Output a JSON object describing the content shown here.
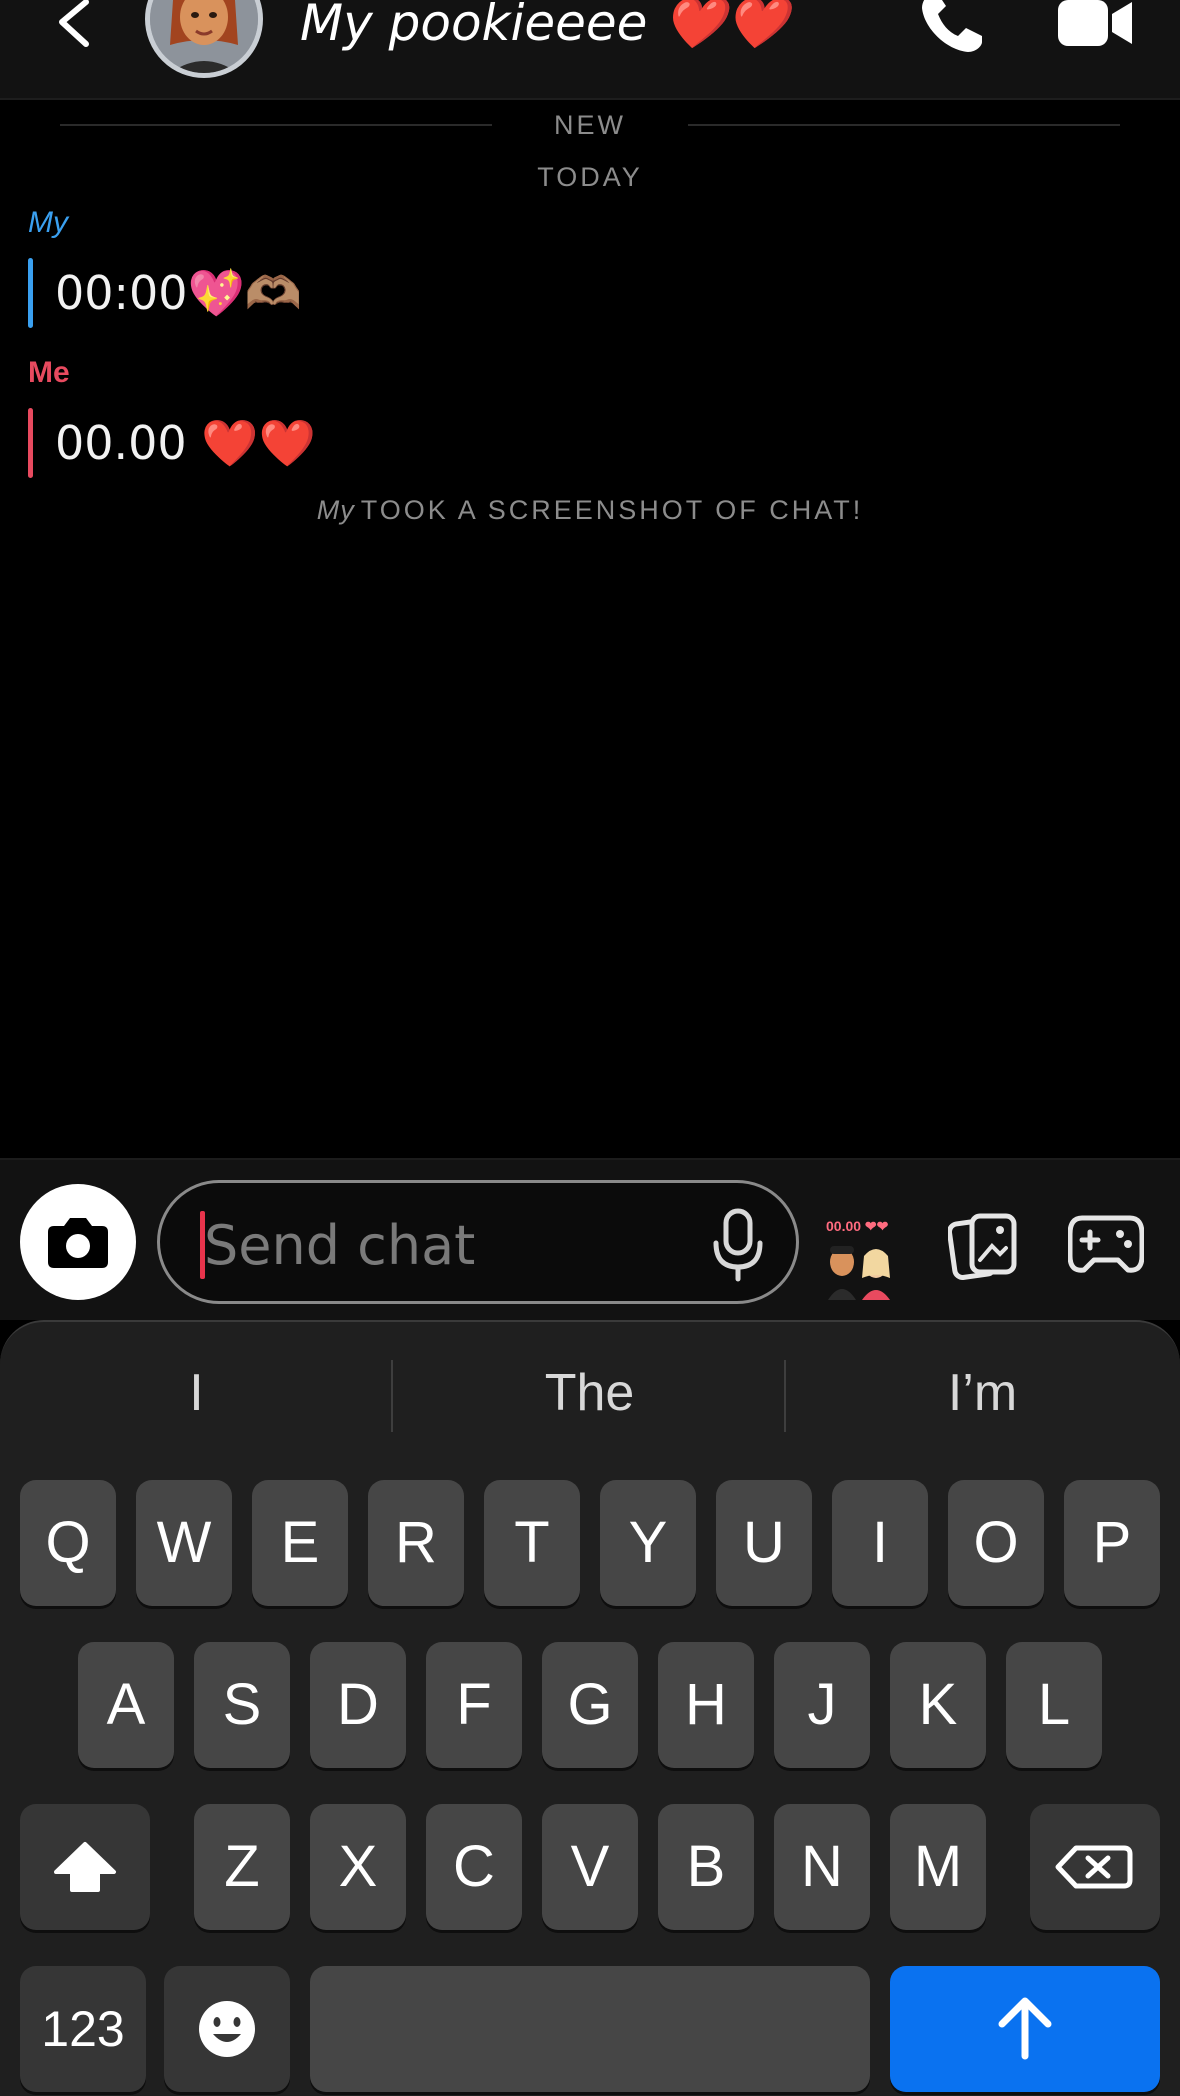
{
  "header": {
    "title": "My pookieeee ❤️❤️",
    "back_icon": "chevron-left-icon",
    "call_icon": "phone-icon",
    "video_icon": "video-camera-icon"
  },
  "chat": {
    "divider_new": "NEW",
    "divider_today": "TODAY",
    "messages": [
      {
        "sender": "My",
        "text": "00:00💖🫶🏽",
        "color": "#3aa0f0"
      },
      {
        "sender": "Me",
        "text": "00.00 ❤️❤️",
        "color": "#e84a5f"
      }
    ],
    "screenshot_notice": {
      "who": "My",
      "text": "TOOK A SCREENSHOT OF CHAT!"
    }
  },
  "composer": {
    "placeholder": "Send chat",
    "bitmoji_caption": "00.00 ❤❤",
    "camera_icon": "camera-icon",
    "mic_icon": "microphone-icon",
    "memories_icon": "memories-icon",
    "games_icon": "game-controller-icon"
  },
  "keyboard": {
    "suggestions": [
      "I",
      "The",
      "I’m"
    ],
    "row1": [
      "Q",
      "W",
      "E",
      "R",
      "T",
      "Y",
      "U",
      "I",
      "O",
      "P"
    ],
    "row2": [
      "A",
      "S",
      "D",
      "F",
      "G",
      "H",
      "J",
      "K",
      "L"
    ],
    "row3": [
      "Z",
      "X",
      "C",
      "V",
      "B",
      "N",
      "M"
    ],
    "numbers_label": "123",
    "shift_icon": "shift-icon",
    "backspace_icon": "backspace-icon",
    "emoji_icon": "emoji-icon",
    "return_icon": "send-arrow-icon",
    "return_color": "#0a72f0"
  }
}
